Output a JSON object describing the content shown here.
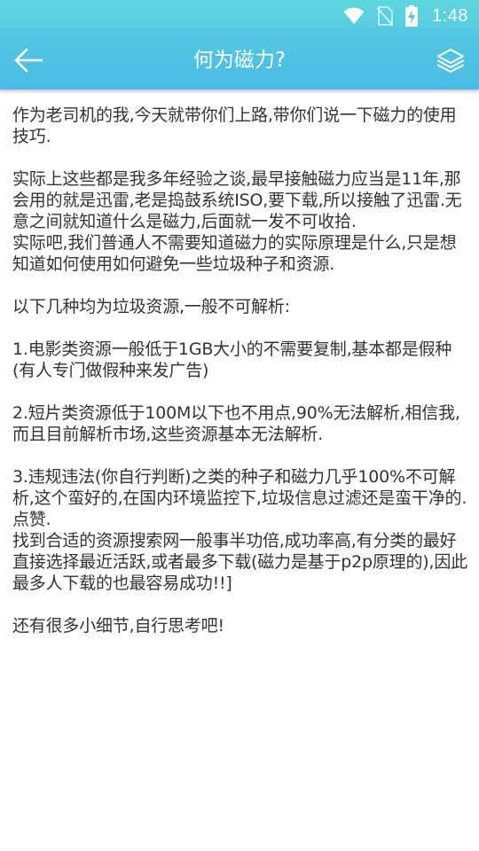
{
  "status_bar": {
    "time": "1:48",
    "icons": [
      "wifi-icon",
      "no-sim-icon",
      "battery-charging-icon"
    ]
  },
  "header": {
    "title": "何为磁力?",
    "back_icon": "arrow-left-icon",
    "action_icon": "layers-icon"
  },
  "colors": {
    "header_top": "#5fd7de",
    "header_bottom": "#49bbe6",
    "text": "#333333"
  },
  "article": {
    "p1": "作为老司机的我,今天就带你们上路,带你们说一下磁力的使用技巧.",
    "p2": "实际上这些都是我多年经验之谈,最早接触磁力应当是11年,那会用的就是迅雷,老是捣鼓系统ISO,要下载,所以接触了迅雷.无意之间就知道什么是磁力,后面就一发不可收拾.",
    "p3": "实际吧,我们普通人不需要知道磁力的实际原理是什么,只是想知道如何使用如何避免一些垃圾种子和资源.",
    "p4": "以下几种均为垃圾资源,一般不可解析:",
    "p5": "1.电影类资源一般低于1GB大小的不需要复制,基本都是假种(有人专门做假种来发广告)",
    "p6": "2.短片类资源低于100M以下也不用点,90%无法解析,相信我,而且目前解析市场,这些资源基本无法解析.",
    "p7": "3.违规违法(你自行判断)之类的种子和磁力几乎100%不可解析,这个蛮好的,在国内环境监控下,垃圾信息过滤还是蛮干净的.点赞.",
    "p8": "找到合适的资源搜索网一般事半功倍,成功率高,有分类的最好直接选择最近活跃,或者最多下载(磁力是基于p2p原理的),因此最多人下载的也最容易成功!!]",
    "p9": "还有很多小细节,自行思考吧!"
  }
}
